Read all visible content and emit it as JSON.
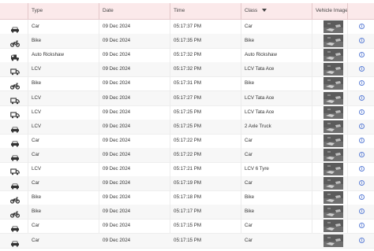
{
  "table": {
    "columns": {
      "type": "Type",
      "date": "Date",
      "time": "Time",
      "class": "Class",
      "image": "Vehicle Image"
    },
    "rows": [
      {
        "icon": "car-icon",
        "type": "Car",
        "date": "09 Dec 2024",
        "time": "05:17:37 PM",
        "class": "Car"
      },
      {
        "icon": "bike-icon",
        "type": "Bike",
        "date": "09 Dec 2024",
        "time": "05:17:35 PM",
        "class": "Bike"
      },
      {
        "icon": "auto-rickshaw-icon",
        "type": "Auto Rickshaw",
        "date": "09 Dec 2024",
        "time": "05:17:32 PM",
        "class": "Auto Rickshaw"
      },
      {
        "icon": "truck-icon",
        "type": "LCV",
        "date": "09 Dec 2024",
        "time": "05:17:32 PM",
        "class": "LCV Tata Ace"
      },
      {
        "icon": "bike-icon",
        "type": "Bike",
        "date": "09 Dec 2024",
        "time": "05:17:31 PM",
        "class": "Bike"
      },
      {
        "icon": "truck-icon",
        "type": "LCV",
        "date": "09 Dec 2024",
        "time": "05:17:27 PM",
        "class": "LCV Tata Ace"
      },
      {
        "icon": "truck-icon",
        "type": "LCV",
        "date": "09 Dec 2024",
        "time": "05:17:25 PM",
        "class": "LCV Tata Ace"
      },
      {
        "icon": "car-icon",
        "type": "LCV",
        "date": "09 Dec 2024",
        "time": "05:17:25 PM",
        "class": "2 Axle Truck"
      },
      {
        "icon": "car-icon",
        "type": "Car",
        "date": "09 Dec 2024",
        "time": "05:17:22 PM",
        "class": "Car"
      },
      {
        "icon": "car-icon",
        "type": "Car",
        "date": "09 Dec 2024",
        "time": "05:17:22 PM",
        "class": "Car"
      },
      {
        "icon": "truck-icon",
        "type": "LCV",
        "date": "09 Dec 2024",
        "time": "05:17:21 PM",
        "class": "LCV 6 Tyre"
      },
      {
        "icon": "car-icon",
        "type": "Car",
        "date": "09 Dec 2024",
        "time": "05:17:19 PM",
        "class": "Car"
      },
      {
        "icon": "bike-icon",
        "type": "Bike",
        "date": "09 Dec 2024",
        "time": "05:17:18 PM",
        "class": "Bike"
      },
      {
        "icon": "bike-icon",
        "type": "Bike",
        "date": "09 Dec 2024",
        "time": "05:17:17 PM",
        "class": "Bike"
      },
      {
        "icon": "car-icon",
        "type": "Car",
        "date": "09 Dec 2024",
        "time": "05:17:15 PM",
        "class": "Car"
      },
      {
        "icon": "car-icon",
        "type": "Car",
        "date": "09 Dec 2024",
        "time": "05:17:15 PM",
        "class": "Car"
      }
    ],
    "info_glyph": "i"
  }
}
